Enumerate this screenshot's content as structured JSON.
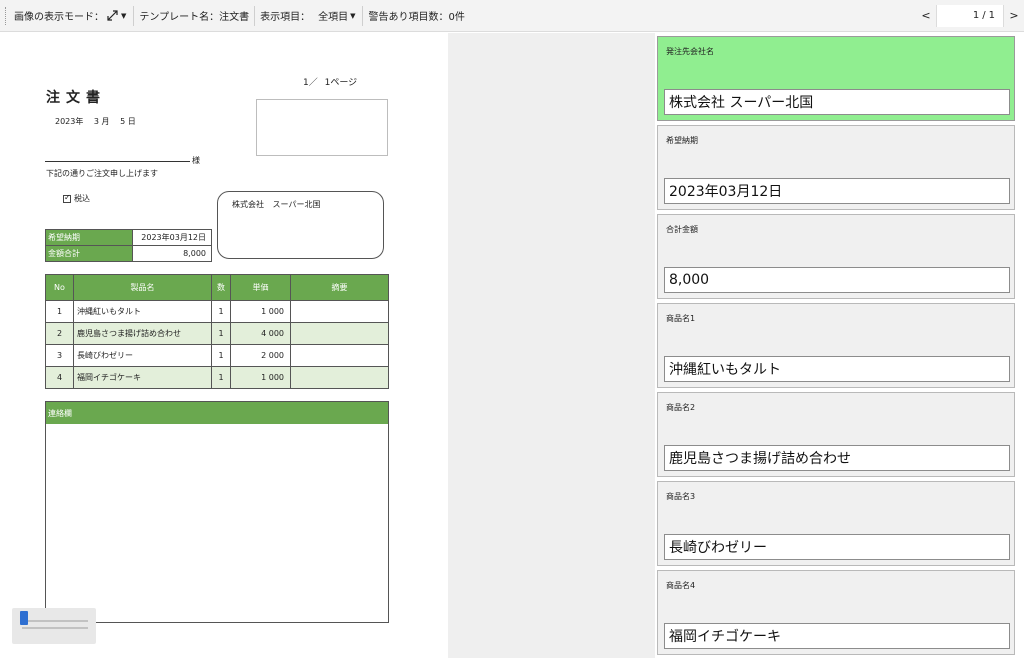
{
  "toolbar": {
    "display_mode_label": "画像の表示モード：",
    "display_mode_icon": "expand-arrows-icon",
    "template_label": "テンプレート名：注文書",
    "items_label": "表示項目：",
    "items_value": "全項目",
    "warning_label": "警告あり項目数：0件",
    "pager": {
      "prev": "<",
      "current": "1",
      "separator": "/",
      "total": "1",
      "next": ">"
    }
  },
  "document": {
    "title": "注文書",
    "page_current": "1／",
    "page_total": "1ページ",
    "date_year": "2023年",
    "date_month": "3 月",
    "date_day": "5 日",
    "addressee_suffix": "様",
    "note": "下記の通りご注文申し上げます",
    "tax_label": "税込",
    "supplier_prefix": "株式会社",
    "supplier_name": "スーパー北国",
    "summary": [
      {
        "label": "希望納期",
        "value": "2023年03月12日"
      },
      {
        "label": "金額合計",
        "value": "8,000"
      }
    ],
    "table_headers": {
      "no": "No",
      "name": "製品名",
      "qty": "数",
      "price": "単価",
      "note": "摘要"
    },
    "rows": [
      {
        "no": "1",
        "name": "沖縄紅いもタルト",
        "qty": "1",
        "price": "1 000",
        "note": ""
      },
      {
        "no": "2",
        "name": "鹿児島さつま揚げ詰め合わせ",
        "qty": "1",
        "price": "4 000",
        "note": ""
      },
      {
        "no": "3",
        "name": "長崎びわゼリー",
        "qty": "1",
        "price": "2 000",
        "note": ""
      },
      {
        "no": "4",
        "name": "福岡イチゴケーキ",
        "qty": "1",
        "price": "1 000",
        "note": ""
      }
    ],
    "memo_label": "連絡欄"
  },
  "fields": [
    {
      "label": "発注先会社名",
      "value": "株式会社 スーパー北国",
      "active": true
    },
    {
      "label": "希望納期",
      "value": "2023年03月12日",
      "active": false
    },
    {
      "label": "合計金額",
      "value": "8,000",
      "active": false
    },
    {
      "label": "商品名1",
      "value": "沖縄紅いもタルト",
      "active": false
    },
    {
      "label": "商品名2",
      "value": "鹿児島さつま揚げ詰め合わせ",
      "active": false
    },
    {
      "label": "商品名3",
      "value": "長崎びわゼリー",
      "active": false
    },
    {
      "label": "商品名4",
      "value": "福岡イチゴケーキ",
      "active": false
    }
  ],
  "zoom": {
    "level": 0.05
  },
  "colors": {
    "header_green": "#6aa84f",
    "active_field": "#90ee90",
    "zoom_thumb": "#2e6fd1"
  }
}
